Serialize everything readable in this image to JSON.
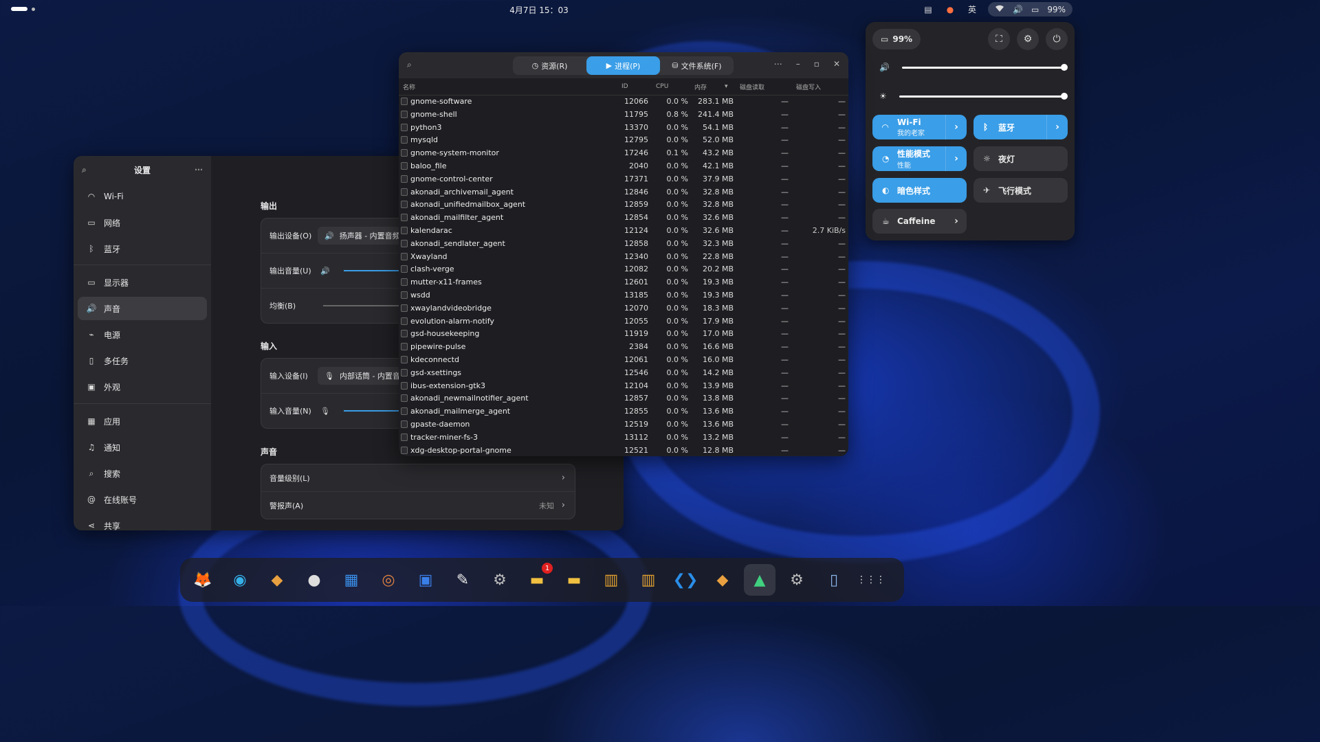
{
  "topbar": {
    "clock": "4月7日  15：03",
    "input_method": "英",
    "battery": "99%"
  },
  "quick_settings": {
    "battery": "99%",
    "tiles": {
      "wifi": {
        "title": "Wi-Fi",
        "sub": "我的老家"
      },
      "bluetooth": {
        "title": "蓝牙"
      },
      "power_mode": {
        "title": "性能模式",
        "sub": "性能"
      },
      "night_light": {
        "title": "夜灯"
      },
      "dark_style": {
        "title": "暗色样式"
      },
      "airplane": {
        "title": "飞行模式"
      },
      "caffeine": {
        "title": "Caffeine"
      }
    },
    "volume_level": 1.0,
    "brightness_level": 1.0
  },
  "settings": {
    "title": "设置",
    "sidebar": [
      {
        "label": "Wi-Fi",
        "icon": "wifi-icon"
      },
      {
        "label": "网络",
        "icon": "network-icon"
      },
      {
        "label": "蓝牙",
        "icon": "bluetooth-icon"
      },
      {
        "label": "显示器",
        "icon": "display-icon"
      },
      {
        "label": "声音",
        "icon": "speaker-icon"
      },
      {
        "label": "电源",
        "icon": "power-icon"
      },
      {
        "label": "多任务",
        "icon": "multitask-icon"
      },
      {
        "label": "外观",
        "icon": "appearance-icon"
      },
      {
        "label": "应用",
        "icon": "apps-icon"
      },
      {
        "label": "通知",
        "icon": "bell-icon"
      },
      {
        "label": "搜索",
        "icon": "search-icon"
      },
      {
        "label": "在线账号",
        "icon": "at-icon"
      },
      {
        "label": "共享",
        "icon": "share-icon"
      }
    ],
    "output": {
      "title": "输出",
      "device_label": "输出设备(O)",
      "device_value": "扬声器 - 内置音频",
      "volume_label": "输出音量(U)",
      "balance_label": "均衡(B)"
    },
    "input": {
      "title": "输入",
      "device_label": "输入设备(I)",
      "device_value": "内部话筒 - 内置音频",
      "volume_label": "输入音量(N)"
    },
    "sound": {
      "title": "声音",
      "levels_label": "音量级别(L)",
      "alert_label": "警报声(A)",
      "alert_value": "未知"
    }
  },
  "sysmon": {
    "tabs": [
      {
        "label": "资源(R)",
        "icon": "gauge-icon"
      },
      {
        "label": "进程(P)",
        "icon": "play-icon"
      },
      {
        "label": "文件系统(F)",
        "icon": "drive-icon"
      }
    ],
    "columns": {
      "name": "名称",
      "id": "ID",
      "cpu": "CPU",
      "mem": "内存",
      "disk_read": "磁盘读取",
      "disk_write": "磁盘写入"
    },
    "processes": [
      {
        "name": "gnome-software",
        "id": "12066",
        "cpu": "0.0 %",
        "mem": "283.1 MB",
        "dr": "—",
        "dw": "—"
      },
      {
        "name": "gnome-shell",
        "id": "11795",
        "cpu": "0.8 %",
        "mem": "241.4 MB",
        "dr": "—",
        "dw": "—"
      },
      {
        "name": "python3",
        "id": "13370",
        "cpu": "0.0 %",
        "mem": "54.1 MB",
        "dr": "—",
        "dw": "—"
      },
      {
        "name": "mysqld",
        "id": "12795",
        "cpu": "0.0 %",
        "mem": "52.0 MB",
        "dr": "—",
        "dw": "—"
      },
      {
        "name": "gnome-system-monitor",
        "id": "17246",
        "cpu": "0.1 %",
        "mem": "43.2 MB",
        "dr": "—",
        "dw": "—"
      },
      {
        "name": "baloo_file",
        "id": "2040",
        "cpu": "0.0 %",
        "mem": "42.1 MB",
        "dr": "—",
        "dw": "—"
      },
      {
        "name": "gnome-control-center",
        "id": "17371",
        "cpu": "0.0 %",
        "mem": "37.9 MB",
        "dr": "—",
        "dw": "—"
      },
      {
        "name": "akonadi_archivemail_agent",
        "id": "12846",
        "cpu": "0.0 %",
        "mem": "32.8 MB",
        "dr": "—",
        "dw": "—"
      },
      {
        "name": "akonadi_unifiedmailbox_agent",
        "id": "12859",
        "cpu": "0.0 %",
        "mem": "32.8 MB",
        "dr": "—",
        "dw": "—"
      },
      {
        "name": "akonadi_mailfilter_agent",
        "id": "12854",
        "cpu": "0.0 %",
        "mem": "32.6 MB",
        "dr": "—",
        "dw": "—"
      },
      {
        "name": "kalendarac",
        "id": "12124",
        "cpu": "0.0 %",
        "mem": "32.6 MB",
        "dr": "—",
        "dw": "2.7 KiB/s"
      },
      {
        "name": "akonadi_sendlater_agent",
        "id": "12858",
        "cpu": "0.0 %",
        "mem": "32.3 MB",
        "dr": "—",
        "dw": "—"
      },
      {
        "name": "Xwayland",
        "id": "12340",
        "cpu": "0.0 %",
        "mem": "22.8 MB",
        "dr": "—",
        "dw": "—"
      },
      {
        "name": "clash-verge",
        "id": "12082",
        "cpu": "0.0 %",
        "mem": "20.2 MB",
        "dr": "—",
        "dw": "—"
      },
      {
        "name": "mutter-x11-frames",
        "id": "12601",
        "cpu": "0.0 %",
        "mem": "19.3 MB",
        "dr": "—",
        "dw": "—"
      },
      {
        "name": "wsdd",
        "id": "13185",
        "cpu": "0.0 %",
        "mem": "19.3 MB",
        "dr": "—",
        "dw": "—"
      },
      {
        "name": "xwaylandvideobridge",
        "id": "12070",
        "cpu": "0.0 %",
        "mem": "18.3 MB",
        "dr": "—",
        "dw": "—"
      },
      {
        "name": "evolution-alarm-notify",
        "id": "12055",
        "cpu": "0.0 %",
        "mem": "17.9 MB",
        "dr": "—",
        "dw": "—"
      },
      {
        "name": "gsd-housekeeping",
        "id": "11919",
        "cpu": "0.0 %",
        "mem": "17.0 MB",
        "dr": "—",
        "dw": "—"
      },
      {
        "name": "pipewire-pulse",
        "id": "2384",
        "cpu": "0.0 %",
        "mem": "16.6 MB",
        "dr": "—",
        "dw": "—"
      },
      {
        "name": "kdeconnectd",
        "id": "12061",
        "cpu": "0.0 %",
        "mem": "16.0 MB",
        "dr": "—",
        "dw": "—"
      },
      {
        "name": "gsd-xsettings",
        "id": "12546",
        "cpu": "0.0 %",
        "mem": "14.2 MB",
        "dr": "—",
        "dw": "—"
      },
      {
        "name": "ibus-extension-gtk3",
        "id": "12104",
        "cpu": "0.0 %",
        "mem": "13.9 MB",
        "dr": "—",
        "dw": "—"
      },
      {
        "name": "akonadi_newmailnotifier_agent",
        "id": "12857",
        "cpu": "0.0 %",
        "mem": "13.8 MB",
        "dr": "—",
        "dw": "—"
      },
      {
        "name": "akonadi_mailmerge_agent",
        "id": "12855",
        "cpu": "0.0 %",
        "mem": "13.6 MB",
        "dr": "—",
        "dw": "—"
      },
      {
        "name": "gpaste-daemon",
        "id": "12519",
        "cpu": "0.0 %",
        "mem": "13.6 MB",
        "dr": "—",
        "dw": "—"
      },
      {
        "name": "tracker-miner-fs-3",
        "id": "13112",
        "cpu": "0.0 %",
        "mem": "13.2 MB",
        "dr": "—",
        "dw": "—"
      },
      {
        "name": "xdg-desktop-portal-gnome",
        "id": "12521",
        "cpu": "0.0 %",
        "mem": "12.8 MB",
        "dr": "—",
        "dw": "—"
      }
    ]
  },
  "dock": {
    "items": [
      {
        "icon": "firefox-icon"
      },
      {
        "icon": "edge-icon"
      },
      {
        "icon": "app-icon"
      },
      {
        "icon": "github-icon"
      },
      {
        "icon": "calendar-icon"
      },
      {
        "icon": "music-icon"
      },
      {
        "icon": "store-icon"
      },
      {
        "icon": "text-editor-icon"
      },
      {
        "icon": "settings-icon"
      },
      {
        "icon": "files-icon",
        "badge": "1"
      },
      {
        "icon": "files-icon"
      },
      {
        "icon": "office-icon"
      },
      {
        "icon": "office-icon"
      },
      {
        "icon": "vscode-icon"
      },
      {
        "icon": "app-icon"
      },
      {
        "icon": "system-monitor-icon"
      },
      {
        "icon": "settings-icon"
      },
      {
        "icon": "trash-icon"
      },
      {
        "icon": "app-grid-icon"
      }
    ]
  }
}
